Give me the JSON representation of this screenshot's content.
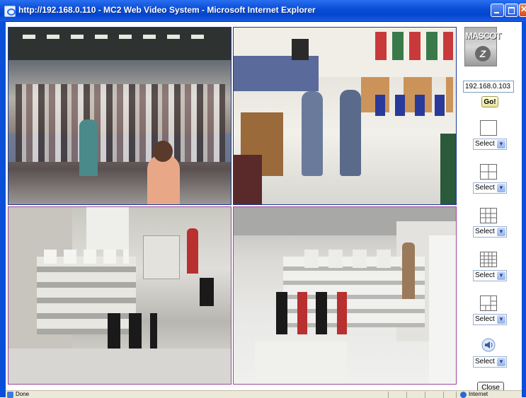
{
  "window": {
    "title": "http://192.168.0.110 - MC2 Web Video System - Microsoft Internet Explorer",
    "icons": [
      "ie-icon",
      "minimize-icon",
      "maximize-icon",
      "close-icon"
    ]
  },
  "cameras": [
    {
      "id": "camera-1",
      "scene": "crowded hall"
    },
    {
      "id": "camera-2",
      "scene": "office lobby"
    },
    {
      "id": "camera-3",
      "scene": "computer lab"
    },
    {
      "id": "camera-4",
      "scene": "computer lab"
    }
  ],
  "panel": {
    "logo_text": "MASCOT",
    "logo_mark": "Z",
    "ip_value": "192.168.0.103",
    "go_label": "Go!",
    "layouts": [
      {
        "icon": "single-view-icon",
        "select_label": "Select"
      },
      {
        "icon": "quad-view-icon",
        "select_label": "Select"
      },
      {
        "icon": "nine-view-icon",
        "select_label": "Select"
      },
      {
        "icon": "sixteen-view-icon",
        "select_label": "Select"
      },
      {
        "icon": "custom-view-icon",
        "select_label": "Select"
      }
    ],
    "audio": {
      "icon": "speaker-icon",
      "select_label": "Select"
    },
    "close_label": "Close"
  },
  "statusbar": {
    "status_text": "Done",
    "zone_text": "Internet"
  },
  "colors": {
    "titlebar": "#0a4fd8",
    "top_row_border": "#1a3a9a",
    "bottom_row_border": "#9a4a9a"
  }
}
